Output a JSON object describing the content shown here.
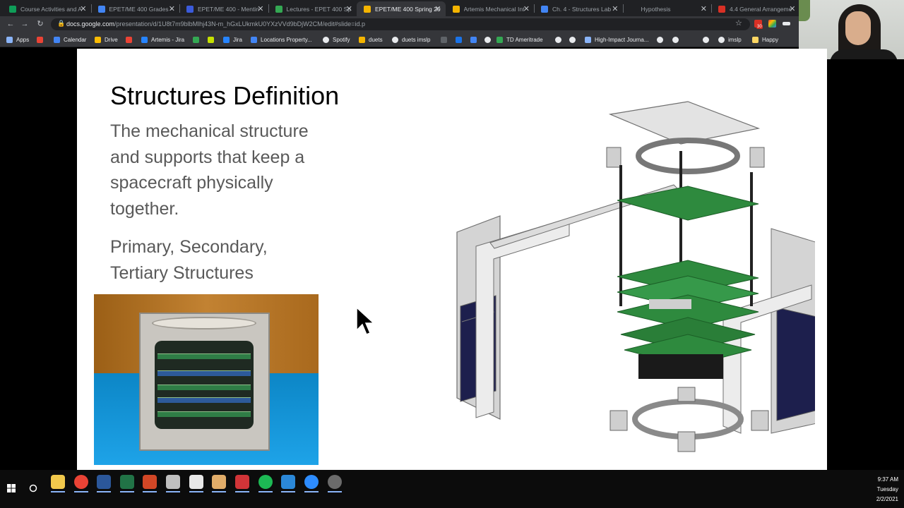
{
  "browser": {
    "tabs": [
      {
        "title": "Course Activities and A",
        "color": "#0f9d58"
      },
      {
        "title": "EPET/ME 400 Grades -",
        "color": "#4285f4"
      },
      {
        "title": "EPET/ME 400 - Mentin",
        "color": "#3b5bdb"
      },
      {
        "title": "Lectures - EPET 400 Sp",
        "color": "#34a853"
      },
      {
        "title": "EPET/ME 400 Spring 20",
        "color": "#f4b400"
      },
      {
        "title": "Artemis Mechanical Int",
        "color": "#f4b400"
      },
      {
        "title": "Ch. 4 - Structures Lab",
        "color": "#4285f4"
      },
      {
        "title": "Hypothesis",
        "color": "#202124"
      },
      {
        "title": "4.4 General Arrangeme",
        "color": "#d93025"
      }
    ],
    "url_host": "docs.google.com",
    "url_path": "/presentation/d/1U8t7m9blbMlhj43N-m_hGxLUkmkU0YXzVVd9bDjW2CM/edit#slide=id.p",
    "extension_badge": "30",
    "bookmarks": [
      {
        "label": "Apps",
        "icon": "apps-grid-icon",
        "color": "#8ab4f8"
      },
      {
        "label": "",
        "icon": "gmail-icon",
        "color": "#ea4335"
      },
      {
        "label": "Calendar",
        "icon": "calendar-icon",
        "color": "#4285f4"
      },
      {
        "label": "Drive",
        "icon": "drive-icon",
        "color": "#fbbc04"
      },
      {
        "label": "",
        "icon": "gmail-icon",
        "color": "#ea4335"
      },
      {
        "label": "Artemis - Jira",
        "icon": "jira-icon",
        "color": "#2684ff"
      },
      {
        "label": "",
        "icon": "leaf-icon",
        "color": "#34a853"
      },
      {
        "label": "",
        "icon": "dj-icon",
        "color": "#c5e000"
      },
      {
        "label": "Jira",
        "icon": "jira-icon",
        "color": "#2684ff"
      },
      {
        "label": "Locations Property...",
        "icon": "location-icon",
        "color": "#4285f4"
      },
      {
        "label": "Spotify",
        "icon": "globe-icon",
        "color": "#e8eaed"
      },
      {
        "label": "duets",
        "icon": "duets-icon",
        "color": "#f4b400"
      },
      {
        "label": "duets imslp",
        "icon": "globe-icon",
        "color": "#e8eaed"
      },
      {
        "label": "",
        "icon": "bookmark-icon",
        "color": "#5f6368"
      },
      {
        "label": "",
        "icon": "circle-icon",
        "color": "#1a73e8"
      },
      {
        "label": "",
        "icon": "gear-icon",
        "color": "#4285f4"
      },
      {
        "label": "",
        "icon": "globe-icon",
        "color": "#e8eaed"
      },
      {
        "label": "TD Ameritrade",
        "icon": "td-icon",
        "color": "#34a853"
      },
      {
        "label": "",
        "icon": "globe-icon",
        "color": "#e8eaed"
      },
      {
        "label": "",
        "icon": "globe-icon",
        "color": "#e8eaed"
      },
      {
        "label": "High-Impact Journa...",
        "icon": "cloud-icon",
        "color": "#8ab4f8"
      },
      {
        "label": "",
        "icon": "globe-icon",
        "color": "#e8eaed"
      },
      {
        "label": "",
        "icon": "globe-icon",
        "color": "#e8eaed"
      },
      {
        "label": "",
        "icon": "globe-icon",
        "color": "#e8eaed"
      },
      {
        "label": "imslp",
        "icon": "globe-icon",
        "color": "#e8eaed"
      },
      {
        "label": "Happy",
        "icon": "folder-icon",
        "color": "#fdd663"
      }
    ]
  },
  "slide": {
    "title": "Structures Definition",
    "description": "The mechanical structure and supports that keep a spacecraft physically together.",
    "types": "Primary, Secondary, Tertiary Structures"
  },
  "taskbar": {
    "apps": [
      {
        "icon": "file-explorer-icon",
        "color": "#f2c94c"
      },
      {
        "icon": "chrome-icon",
        "color": "#ea4335"
      },
      {
        "icon": "word-icon",
        "color": "#2b579a"
      },
      {
        "icon": "excel-icon",
        "color": "#217346"
      },
      {
        "icon": "powerpoint-icon",
        "color": "#d24726"
      },
      {
        "icon": "paint-icon",
        "color": "#bfbfbf"
      },
      {
        "icon": "acrobat-icon",
        "color": "#e8e8e8"
      },
      {
        "icon": "slack-icon",
        "color": "#e0ac69"
      },
      {
        "icon": "app-icon",
        "color": "#d13438"
      },
      {
        "icon": "spotify-icon",
        "color": "#1db954"
      },
      {
        "icon": "chat-icon",
        "color": "#2b88d8"
      },
      {
        "icon": "zoom-icon",
        "color": "#2d8cff"
      },
      {
        "icon": "chrome-alt-icon",
        "color": "#6b6b6b"
      }
    ],
    "time": "9:37 AM",
    "day": "Tuesday",
    "date": "2/2/2021"
  }
}
